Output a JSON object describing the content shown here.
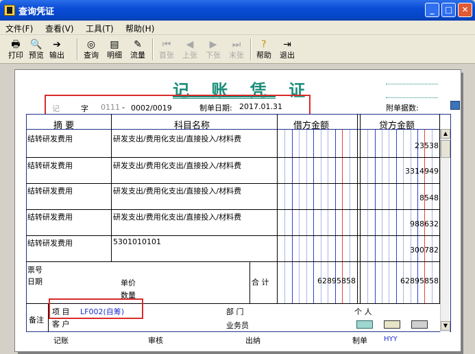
{
  "window": {
    "title": "查询凭证",
    "min": "_",
    "max": "□",
    "close": "✕"
  },
  "menu": [
    "文件(F)",
    "查看(V)",
    "工具(T)",
    "帮助(H)"
  ],
  "toolbar": {
    "print": "打印",
    "preview": "预览",
    "export": "输出",
    "query": "查询",
    "detail": "明细",
    "flow": "流量",
    "first": "首张",
    "prev": "上张",
    "next": "下张",
    "last": "末张",
    "help": "帮助",
    "exit": "退出"
  },
  "voucher": {
    "title": "记 账 凭 证",
    "word_label": "记",
    "zi": "字",
    "number_prefix": "0111",
    "dash": "-",
    "number": "0002/0019",
    "date_label": "制单日期:",
    "date": "2017.01.31",
    "attach_label": "附单据数:"
  },
  "table": {
    "headers": {
      "summary": "摘 要",
      "account": "科目名称",
      "debit": "借方金额",
      "credit": "贷方金额"
    },
    "rows": [
      {
        "summary": "结转研发费用",
        "account": "研发支出/费用化支出/直接投入/材料费",
        "credit": "23538"
      },
      {
        "summary": "结转研发费用",
        "account": "研发支出/费用化支出/直接投入/材料费",
        "credit": "3314949"
      },
      {
        "summary": "结转研发费用",
        "account": "研发支出/费用化支出/直接投入/材料费",
        "credit": "8548"
      },
      {
        "summary": "结转研发费用",
        "account": "研发支出/费用化支出/直接投入/材料费",
        "credit": "988632"
      },
      {
        "summary": "结转研发费用",
        "account": "5301010101",
        "credit": "300782"
      }
    ],
    "ticket_label": "票号",
    "date_label": "日期",
    "unit_price_label": "单价",
    "quantity_label": "数量",
    "total_label": "合 计",
    "debit_total": "62895858",
    "credit_total": "62895858"
  },
  "notes": {
    "label": "备注",
    "project_label": "项  目",
    "project_value": "LF002(自筹)",
    "customer_label": "客  户",
    "dept_label": "部  门",
    "person_label": "个  人",
    "salesman_label": "业务员"
  },
  "footer": {
    "bookkeeping": "记账",
    "review": "审核",
    "cashier": "出纳",
    "maker_label": "制单",
    "maker": "HYY"
  },
  "colors": {
    "accent": "#1a8d7a",
    "highlight": "#d92a2a",
    "grid_blue": "#2b3fd1",
    "grid_red": "#e04040"
  }
}
